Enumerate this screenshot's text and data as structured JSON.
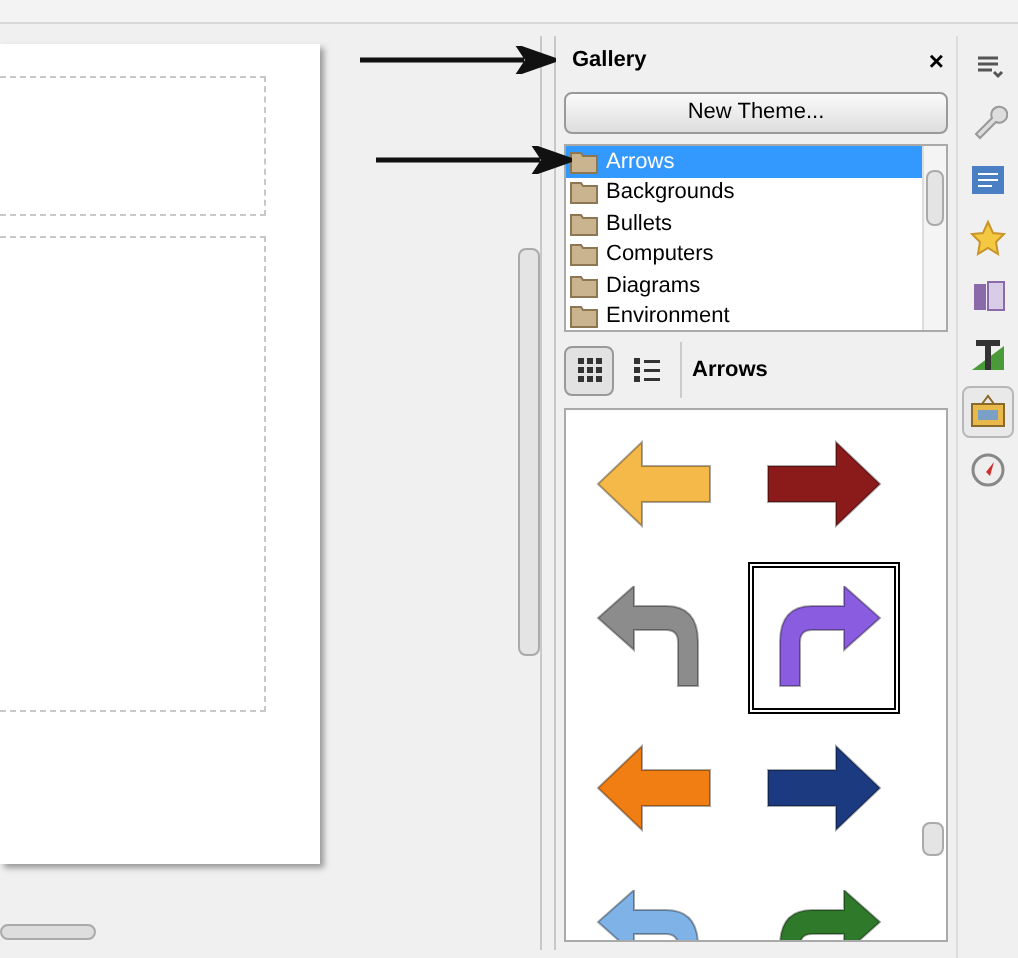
{
  "gallery": {
    "title": "Gallery",
    "close": "×",
    "new_theme": "New Theme...",
    "themes": [
      {
        "label": "Arrows",
        "selected": true
      },
      {
        "label": "Backgrounds",
        "selected": false
      },
      {
        "label": "Bullets",
        "selected": false
      },
      {
        "label": "Computers",
        "selected": false
      },
      {
        "label": "Diagrams",
        "selected": false
      },
      {
        "label": "Environment",
        "selected": false
      }
    ],
    "views": [
      {
        "kind": "icon",
        "selected": true
      },
      {
        "kind": "list",
        "selected": false
      }
    ],
    "theme_name": "Arrows",
    "items": [
      {
        "kind": "left",
        "color": "#f5b94a",
        "selected": false
      },
      {
        "kind": "right",
        "color": "#8b1a1a",
        "selected": false
      },
      {
        "kind": "uturn-left",
        "color": "#8c8c8c",
        "selected": false
      },
      {
        "kind": "uturn-right",
        "color": "#8a5ce0",
        "selected": true
      },
      {
        "kind": "left",
        "color": "#f07e12",
        "selected": false
      },
      {
        "kind": "right",
        "color": "#1c3a80",
        "selected": false
      },
      {
        "kind": "uturn-left",
        "color": "#7fb2e6",
        "selected": false
      },
      {
        "kind": "uturn-right",
        "color": "#2f7a2a",
        "selected": false
      }
    ]
  },
  "sidebar": {
    "items": [
      {
        "kind": "menu",
        "selected": false
      },
      {
        "kind": "properties",
        "selected": false
      },
      {
        "kind": "slides",
        "selected": false
      },
      {
        "kind": "star",
        "selected": false
      },
      {
        "kind": "master",
        "selected": false
      },
      {
        "kind": "styles",
        "selected": false
      },
      {
        "kind": "gallery",
        "selected": true
      },
      {
        "kind": "navigator",
        "selected": false
      }
    ]
  }
}
